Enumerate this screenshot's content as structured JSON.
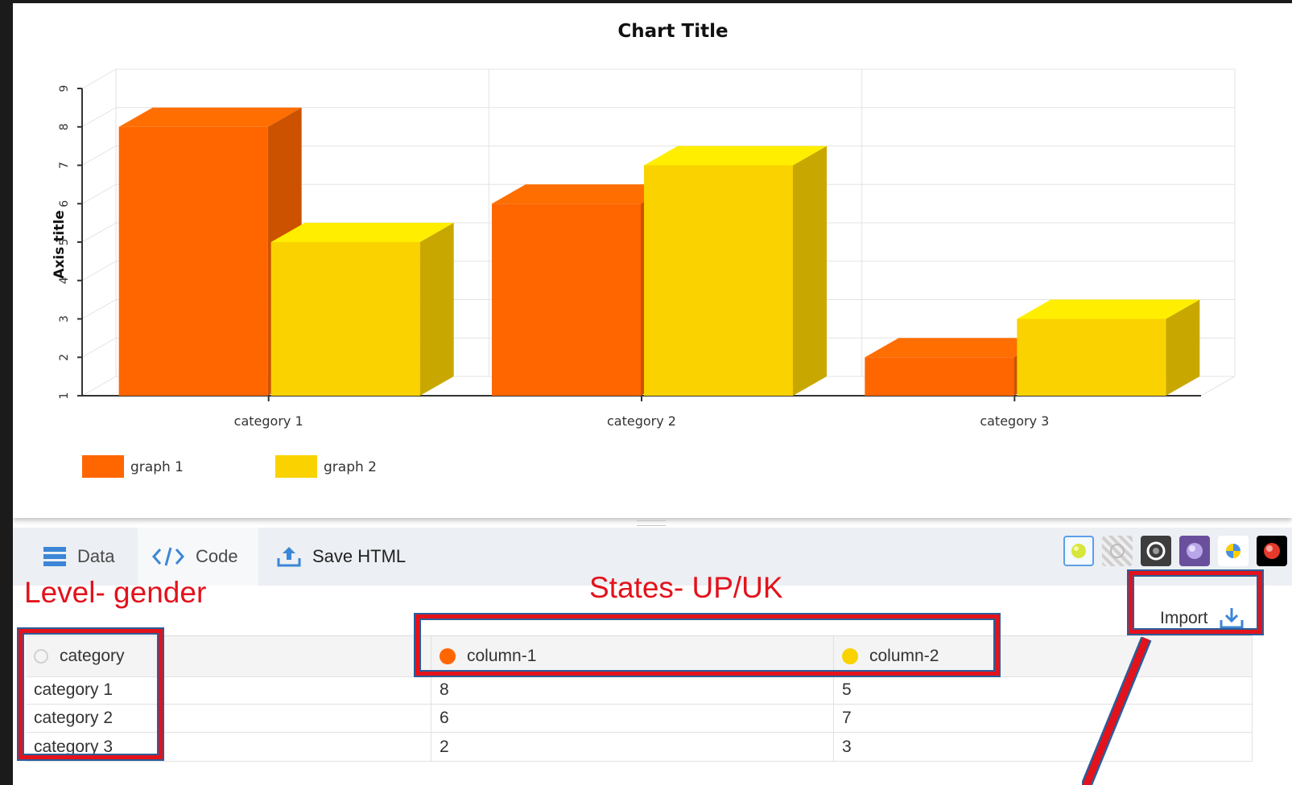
{
  "chart_data": {
    "type": "bar",
    "title": "Chart Title",
    "ylabel": "Axis title",
    "xlabel": "",
    "categories": [
      "category 1",
      "category 2",
      "category 3"
    ],
    "series": [
      {
        "name": "graph 1",
        "values": [
          8,
          6,
          2
        ],
        "color": "#ff6600"
      },
      {
        "name": "graph 2",
        "values": [
          5,
          7,
          3
        ],
        "color": "#fad200"
      }
    ],
    "ylim": [
      1,
      9
    ],
    "yticks": [
      "1",
      "2",
      "3",
      "4",
      "5",
      "6",
      "7",
      "8",
      "9"
    ],
    "style": "3d-column",
    "legend": "bottom-left",
    "grid": true
  },
  "toolbar": {
    "tabs": [
      {
        "label": "Data"
      },
      {
        "label": "Code"
      },
      {
        "label": "Save HTML"
      }
    ],
    "themes": [
      "light-yellow",
      "striped-gray",
      "dark-ring",
      "purple-orb",
      "yellow-blue",
      "red-orb"
    ]
  },
  "annotations": {
    "level": "Level- gender",
    "states": "States- UP/UK"
  },
  "import_label": "Import",
  "grid": {
    "headers": [
      "category",
      "column-1",
      "column-2"
    ],
    "header_colors": [
      "#cfcfcf",
      "#ff6600",
      "#fad200"
    ],
    "rows": [
      [
        "category 1",
        "8",
        "5"
      ],
      [
        "category 2",
        "6",
        "7"
      ],
      [
        "category 3",
        "2",
        "3"
      ]
    ]
  }
}
